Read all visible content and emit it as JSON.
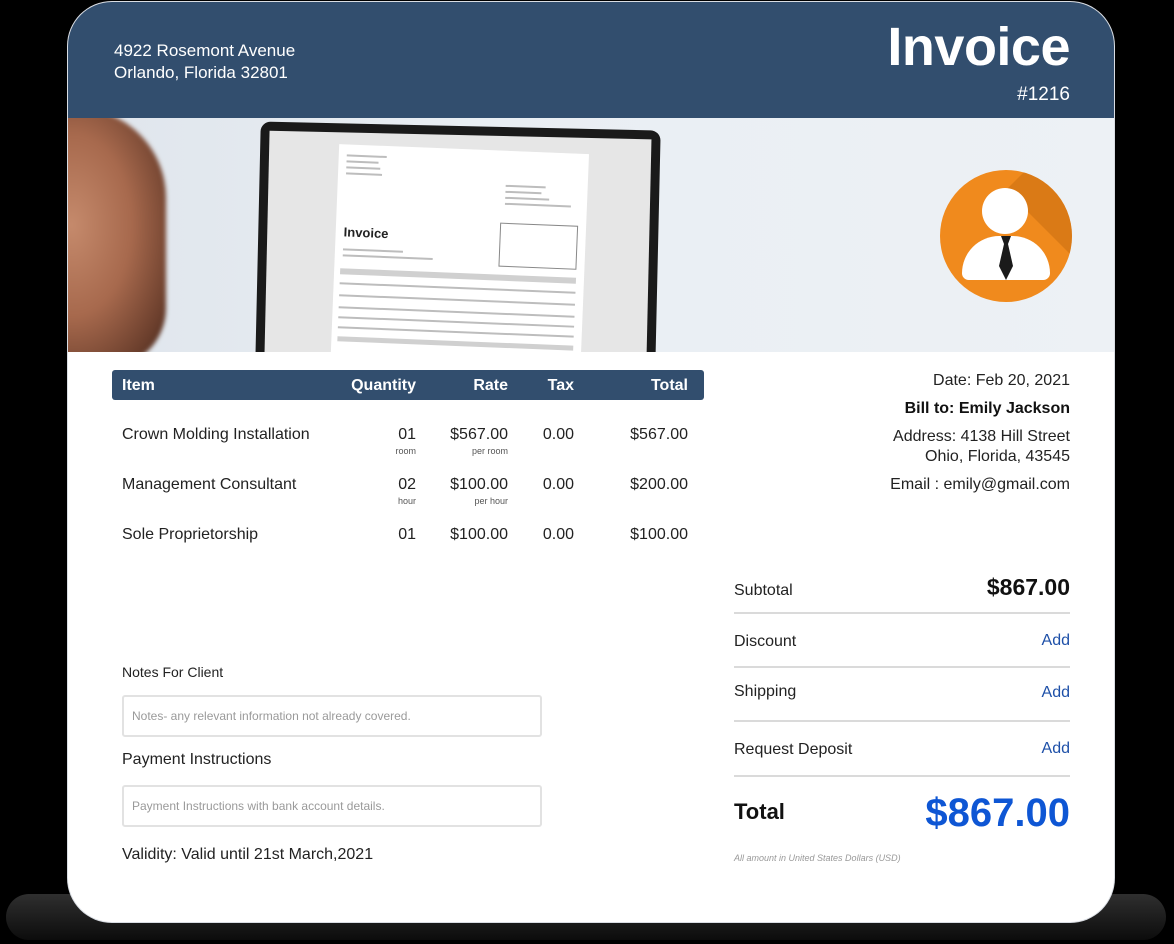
{
  "header": {
    "address_line1": "4922 Rosemont Avenue",
    "address_line2": "Orlando, Florida 32801",
    "title": "Invoice",
    "number": "#1216"
  },
  "banner": {
    "image_description": "person-looking-at-laptop-with-invoice",
    "screen_doc_title": "Invoice",
    "avatar_icon": "user-businessman-icon"
  },
  "items_table": {
    "columns": [
      "Item",
      "Quantity",
      "Rate",
      "Tax",
      "Total"
    ],
    "rows": [
      {
        "item": "Crown Molding Installation",
        "quantity": "01",
        "quantity_unit": "room",
        "rate": "$567.00",
        "rate_unit": "per room",
        "tax": "0.00",
        "total": "$567.00"
      },
      {
        "item": "Management Consultant",
        "quantity": "02",
        "quantity_unit": "hour",
        "rate": "$100.00",
        "rate_unit": "per hour",
        "tax": "0.00",
        "total": "$200.00"
      },
      {
        "item": "Sole Proprietorship",
        "quantity": "01",
        "quantity_unit": "",
        "rate": "$100.00",
        "rate_unit": "",
        "tax": "0.00",
        "total": "$100.00"
      }
    ]
  },
  "bill_info": {
    "date": "Date: Feb 20, 2021",
    "bill_to": "Bill to: Emily Jackson",
    "address_line1": "Address: 4138 Hill Street",
    "address_line2": "Ohio, Florida, 43545",
    "email": "Email : emily@gmail.com"
  },
  "totals": {
    "subtotal_label": "Subtotal",
    "subtotal_value": "$867.00",
    "discount_label": "Discount",
    "shipping_label": "Shipping",
    "deposit_label": "Request Deposit",
    "add_label": "Add",
    "total_label": "Total",
    "total_value": "$867.00",
    "currency_note": "All amount in United States Dollars (USD)"
  },
  "notes": {
    "notes_label": "Notes For Client",
    "notes_placeholder": "Notes- any relevant information not already covered.",
    "payment_label": "Payment Instructions",
    "payment_placeholder": "Payment Instructions with bank account details.",
    "validity": "Validity: Valid until 21st March,2021"
  },
  "colors": {
    "header_bg": "#324e6e",
    "total_accent": "#0e56d4",
    "link": "#1e50a8",
    "avatar": "#f08a1d"
  }
}
